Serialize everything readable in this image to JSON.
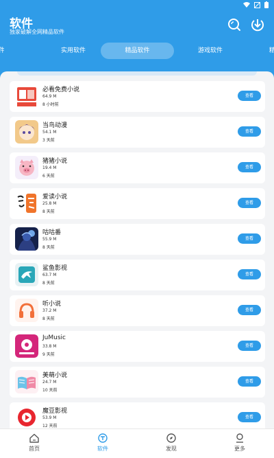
{
  "header": {
    "title": "软件",
    "subtitle": "独家破解全网精品软件",
    "search_icon": "search-icon",
    "download_icon": "download-icon"
  },
  "tabs": [
    {
      "label": "件"
    },
    {
      "label": "实用软件"
    },
    {
      "label": "精品软件",
      "active": true
    },
    {
      "label": "游戏软件"
    },
    {
      "label": "精"
    }
  ],
  "apps": [
    {
      "name": "必看免费小说",
      "size": "64.9 M",
      "time": "8 小时前",
      "button": "查看",
      "icon": "book-icon"
    },
    {
      "name": "当鸟动漫",
      "size": "54.1 M",
      "time": "3 天前",
      "button": "查看",
      "icon": "anime-icon"
    },
    {
      "name": "猪猪小说",
      "size": "19.4 M",
      "time": "6 天前",
      "button": "查看",
      "icon": "pig-icon"
    },
    {
      "name": "爱读小说",
      "size": "25.8 M",
      "time": "8 天前",
      "button": "查看",
      "icon": "read-icon"
    },
    {
      "name": "咕咕番",
      "size": "55.9 M",
      "time": "8 天前",
      "button": "查看",
      "icon": "gugu-icon"
    },
    {
      "name": "鲨鱼影视",
      "size": "63.7 M",
      "time": "8 天前",
      "button": "查看",
      "icon": "shark-icon"
    },
    {
      "name": "听小说",
      "size": "37.2 M",
      "time": "8 天前",
      "button": "查看",
      "icon": "headphones-icon"
    },
    {
      "name": "JuMusic",
      "size": "33.8 M",
      "time": "9 天前",
      "button": "查看",
      "icon": "music-icon"
    },
    {
      "name": "美萌小说",
      "size": "24.7 M",
      "time": "10 天前",
      "button": "查看",
      "icon": "open-book-icon"
    },
    {
      "name": "魔豆影视",
      "size": "53.9 M",
      "time": "12 天前",
      "button": "查看",
      "icon": "play-icon"
    }
  ],
  "bottom_nav": [
    {
      "label": "首页",
      "icon": "home-icon"
    },
    {
      "label": "软件",
      "icon": "software-icon",
      "active": true
    },
    {
      "label": "发现",
      "icon": "compass-icon"
    },
    {
      "label": "更多",
      "icon": "user-icon"
    }
  ],
  "colors": {
    "primary": "#2f9ce8",
    "background": "#f3f4f6",
    "card": "#ffffff"
  }
}
